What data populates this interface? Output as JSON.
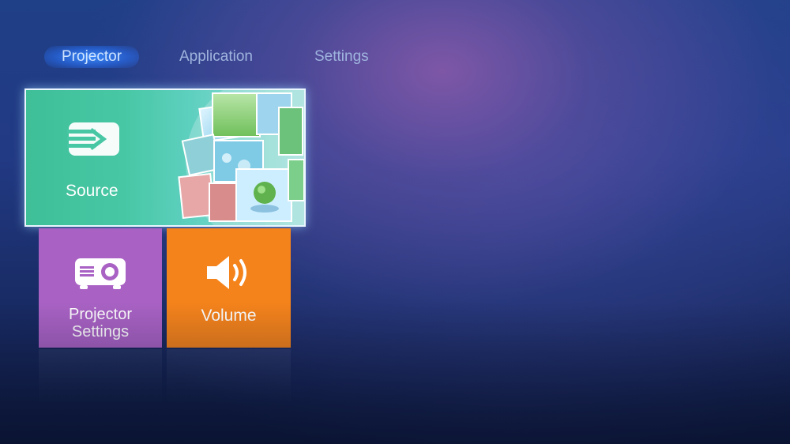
{
  "tabs": [
    {
      "label": "Projector",
      "active": true
    },
    {
      "label": "Application",
      "active": false
    },
    {
      "label": "Settings",
      "active": false
    }
  ],
  "tiles": {
    "source": {
      "label": "Source",
      "icon": "input-arrow-icon",
      "color": "#47c7a4"
    },
    "projector_settings": {
      "label_line1": "Projector",
      "label_line2": "Settings",
      "icon": "projector-icon",
      "color": "#a962c4"
    },
    "volume": {
      "label": "Volume",
      "icon": "speaker-icon",
      "color": "#f5831b"
    }
  },
  "colors": {
    "active_tab_glow": "#3c8cff",
    "inactive_tab_text": "#9fb4de"
  }
}
